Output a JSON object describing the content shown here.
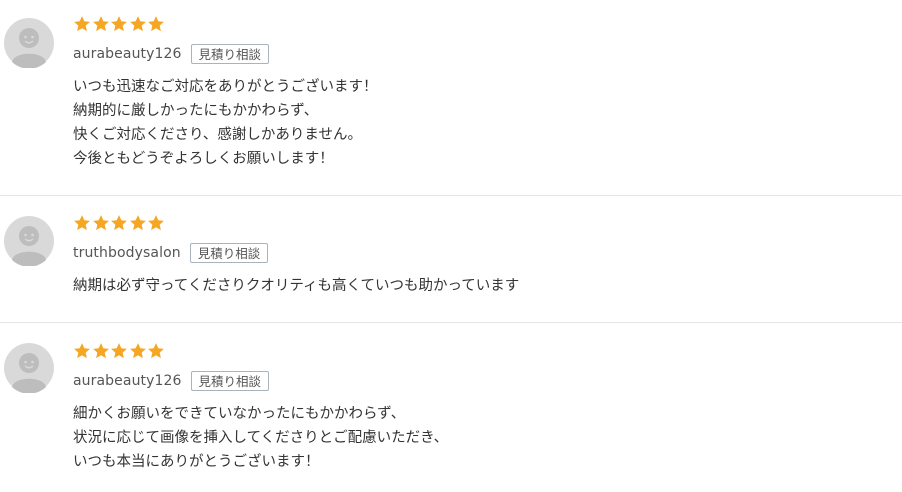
{
  "colors": {
    "star": "#f5a623",
    "avatar_bg": "#d9d9d9",
    "avatar_fg": "#bdbdbd",
    "divider": "#e5e5e5"
  },
  "reviews": [
    {
      "rating": 5,
      "username": "aurabeauty126",
      "badge": "見積り相談",
      "avatar_icon": "default-user-icon",
      "lines": [
        "いつも迅速なご対応をありがとうございます！",
        "納期的に厳しかったにもかかわらず、",
        "快くご対応くださり、感謝しかありません。",
        "今後ともどうぞよろしくお願いします！"
      ]
    },
    {
      "rating": 5,
      "username": "truthbodysalon",
      "badge": "見積り相談",
      "avatar_icon": "default-user-icon",
      "lines": [
        "納期は必ず守ってくださりクオリティも高くていつも助かっています"
      ]
    },
    {
      "rating": 5,
      "username": "aurabeauty126",
      "badge": "見積り相談",
      "avatar_icon": "default-user-icon",
      "lines": [
        "細かくお願いをできていなかったにもかかわらず、",
        "状況に応じて画像を挿入してくださりとご配慮いただき、",
        "いつも本当にありがとうございます！"
      ]
    }
  ]
}
